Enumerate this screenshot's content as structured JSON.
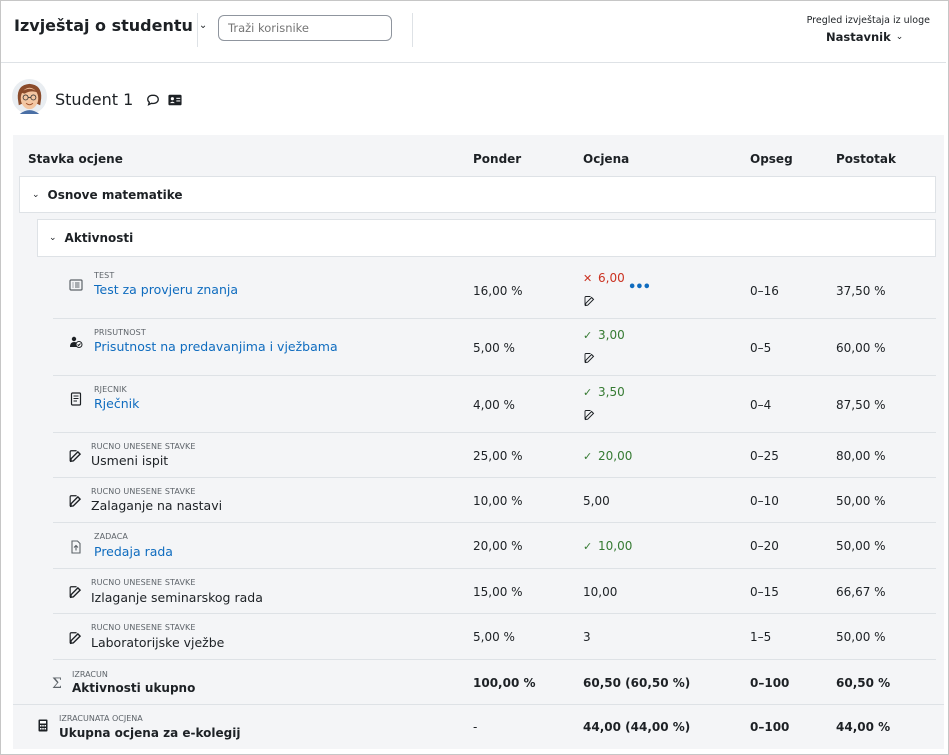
{
  "header": {
    "title": "Izvještaj o studentu",
    "search_placeholder": "Traži korisnike",
    "view_label": "Pregled izvještaja iz uloge",
    "view_value": "Nastavnik"
  },
  "user": {
    "name": "Student 1"
  },
  "columns": {
    "item": "Stavka ocjene",
    "weight": "Ponder",
    "grade": "Ocjena",
    "range": "Opseg",
    "percent": "Postotak"
  },
  "categories": {
    "course": "Osnove matematike",
    "activities": "Aktivnosti"
  },
  "rows": [
    {
      "type": "TEST",
      "name": "Test za provjeru znanja",
      "weight": "16,00 %",
      "grade": "6,00",
      "range": "0–16",
      "percent": "37,50 %"
    },
    {
      "type": "PRISUTNOST",
      "name": "Prisutnost na predavanjima i vježbama",
      "weight": "5,00 %",
      "grade": "3,00",
      "range": "0–5",
      "percent": "60,00 %"
    },
    {
      "type": "RJECNIK",
      "name": "Rječnik",
      "weight": "4,00 %",
      "grade": "3,50",
      "range": "0–4",
      "percent": "87,50 %"
    },
    {
      "type": "RUCNO UNESENE STAVKE",
      "name": "Usmeni ispit",
      "weight": "25,00 %",
      "grade": "20,00",
      "range": "0–25",
      "percent": "80,00 %"
    },
    {
      "type": "RUCNO UNESENE STAVKE",
      "name": "Zalaganje na nastavi",
      "weight": "10,00 %",
      "grade": "5,00",
      "range": "0–10",
      "percent": "50,00 %"
    },
    {
      "type": "ZADACA",
      "name": "Predaja rada",
      "weight": "20,00 %",
      "grade": "10,00",
      "range": "0–20",
      "percent": "50,00 %"
    },
    {
      "type": "RUCNO UNESENE STAVKE",
      "name": "Izlaganje seminarskog rada",
      "weight": "15,00 %",
      "grade": "10,00",
      "range": "0–15",
      "percent": "66,67 %"
    },
    {
      "type": "RUCNO UNESENE STAVKE",
      "name": "Laboratorijske vježbe",
      "weight": "5,00 %",
      "grade": "3",
      "range": "1–5",
      "percent": "50,00 %"
    }
  ],
  "activities_total": {
    "type": "IZRACUN",
    "name": "Aktivnosti ukupno",
    "weight": "100,00 %",
    "grade": "60,50 (60,50 %)",
    "range": "0–100",
    "percent": "60,50 %"
  },
  "course_total": {
    "type": "IZRACUNATA OCJENA",
    "name": "Ukupna ocjena za e-kolegij",
    "weight": "-",
    "grade": "44,00 (44,00 %)",
    "range": "0–100",
    "percent": "44,00 %"
  },
  "colors": {
    "link": "#0f6cbf",
    "ok": "#357a32",
    "bad": "#ca3120"
  }
}
